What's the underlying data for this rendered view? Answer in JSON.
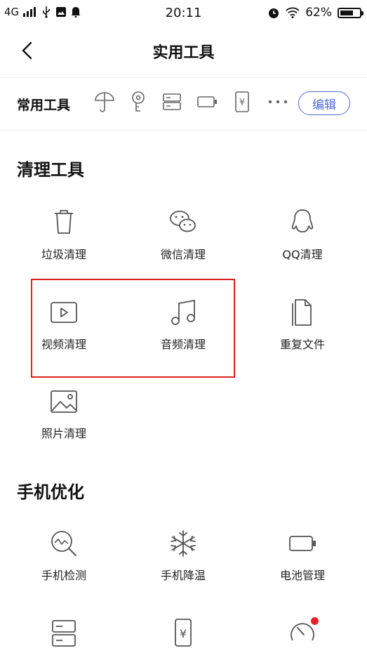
{
  "status_bar": {
    "network": "4G",
    "time": "20:11",
    "battery": "62%"
  },
  "nav": {
    "title": "实用工具"
  },
  "common_tools": {
    "label": "常用工具",
    "edit_label": "编辑",
    "icons": [
      "umbrella-icon",
      "key-icon",
      "storage-icon",
      "battery-icon",
      "payment-icon",
      "more-icon"
    ]
  },
  "cleanup": {
    "title": "清理工具",
    "items": [
      {
        "label": "垃圾清理",
        "icon": "trash-icon"
      },
      {
        "label": "微信清理",
        "icon": "wechat-icon"
      },
      {
        "label": "QQ清理",
        "icon": "qq-icon"
      },
      {
        "label": "视频清理",
        "icon": "video-icon"
      },
      {
        "label": "音频清理",
        "icon": "music-icon"
      },
      {
        "label": "重复文件",
        "icon": "duplicate-file-icon"
      },
      {
        "label": "照片清理",
        "icon": "photo-icon"
      }
    ]
  },
  "optimize": {
    "title": "手机优化",
    "items": [
      {
        "label": "手机检测",
        "icon": "detect-icon"
      },
      {
        "label": "手机降温",
        "icon": "snowflake-icon"
      },
      {
        "label": "电池管理",
        "icon": "battery-icon"
      },
      {
        "label": "",
        "icon": "storage-icon"
      },
      {
        "label": "",
        "icon": "payment-icon"
      },
      {
        "label": "",
        "icon": "speed-icon"
      }
    ]
  },
  "colors": {
    "accent": "#4f6bd8",
    "highlight": "#e02020",
    "icon": "#555555"
  }
}
